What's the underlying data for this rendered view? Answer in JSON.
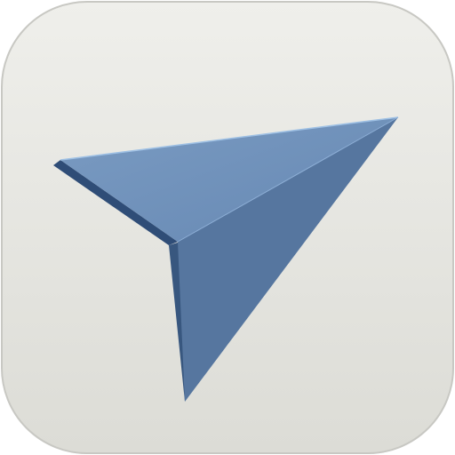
{
  "icon": {
    "name": "paper-plane-send-icon",
    "colors": {
      "tile_top": "#efefeb",
      "tile_bottom": "#dcdcd6",
      "tile_border": "#c8c8c3",
      "plane_light": "#7596be",
      "plane_mid": "#56769f",
      "plane_dark": "#3f5e88",
      "plane_shadow": "#2f4d77",
      "plane_edge": "#9ec0e4"
    }
  }
}
